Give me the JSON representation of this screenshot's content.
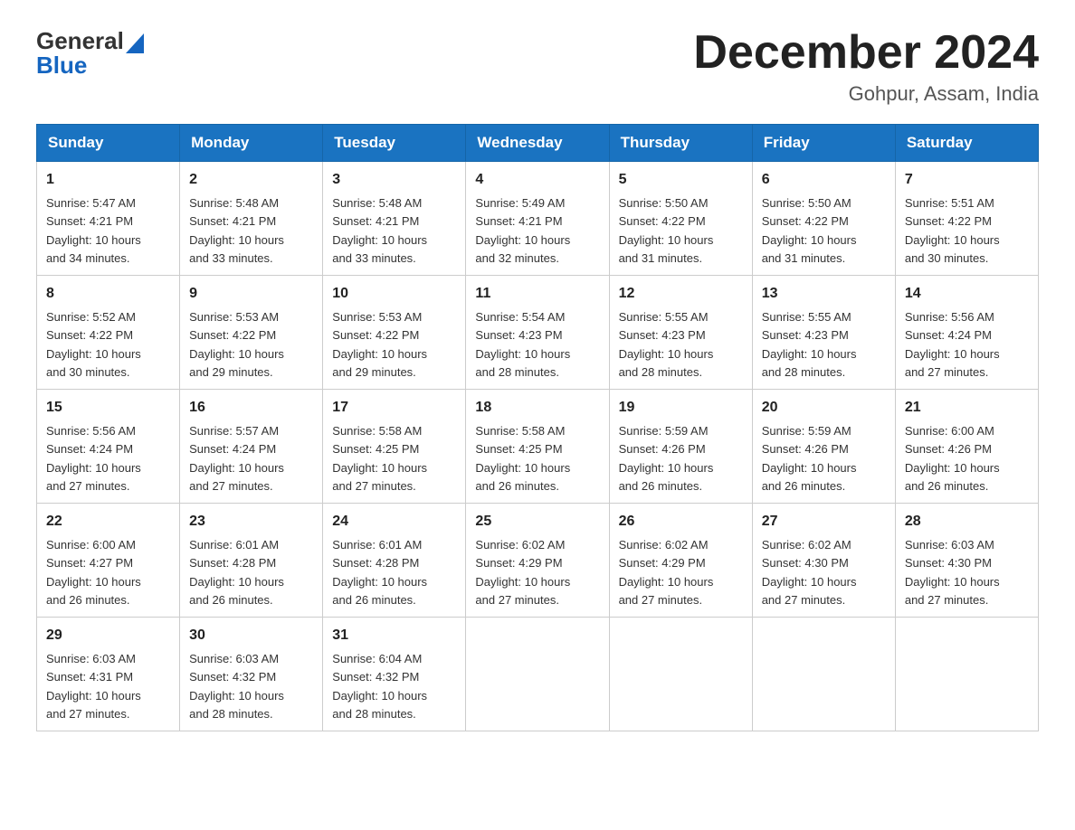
{
  "logo": {
    "text_general": "General",
    "text_blue": "Blue"
  },
  "title": {
    "month": "December 2024",
    "location": "Gohpur, Assam, India"
  },
  "days_of_week": [
    "Sunday",
    "Monday",
    "Tuesday",
    "Wednesday",
    "Thursday",
    "Friday",
    "Saturday"
  ],
  "weeks": [
    [
      {
        "day": "1",
        "sunrise": "5:47 AM",
        "sunset": "4:21 PM",
        "daylight": "10 hours and 34 minutes."
      },
      {
        "day": "2",
        "sunrise": "5:48 AM",
        "sunset": "4:21 PM",
        "daylight": "10 hours and 33 minutes."
      },
      {
        "day": "3",
        "sunrise": "5:48 AM",
        "sunset": "4:21 PM",
        "daylight": "10 hours and 33 minutes."
      },
      {
        "day": "4",
        "sunrise": "5:49 AM",
        "sunset": "4:21 PM",
        "daylight": "10 hours and 32 minutes."
      },
      {
        "day": "5",
        "sunrise": "5:50 AM",
        "sunset": "4:22 PM",
        "daylight": "10 hours and 31 minutes."
      },
      {
        "day": "6",
        "sunrise": "5:50 AM",
        "sunset": "4:22 PM",
        "daylight": "10 hours and 31 minutes."
      },
      {
        "day": "7",
        "sunrise": "5:51 AM",
        "sunset": "4:22 PM",
        "daylight": "10 hours and 30 minutes."
      }
    ],
    [
      {
        "day": "8",
        "sunrise": "5:52 AM",
        "sunset": "4:22 PM",
        "daylight": "10 hours and 30 minutes."
      },
      {
        "day": "9",
        "sunrise": "5:53 AM",
        "sunset": "4:22 PM",
        "daylight": "10 hours and 29 minutes."
      },
      {
        "day": "10",
        "sunrise": "5:53 AM",
        "sunset": "4:22 PM",
        "daylight": "10 hours and 29 minutes."
      },
      {
        "day": "11",
        "sunrise": "5:54 AM",
        "sunset": "4:23 PM",
        "daylight": "10 hours and 28 minutes."
      },
      {
        "day": "12",
        "sunrise": "5:55 AM",
        "sunset": "4:23 PM",
        "daylight": "10 hours and 28 minutes."
      },
      {
        "day": "13",
        "sunrise": "5:55 AM",
        "sunset": "4:23 PM",
        "daylight": "10 hours and 28 minutes."
      },
      {
        "day": "14",
        "sunrise": "5:56 AM",
        "sunset": "4:24 PM",
        "daylight": "10 hours and 27 minutes."
      }
    ],
    [
      {
        "day": "15",
        "sunrise": "5:56 AM",
        "sunset": "4:24 PM",
        "daylight": "10 hours and 27 minutes."
      },
      {
        "day": "16",
        "sunrise": "5:57 AM",
        "sunset": "4:24 PM",
        "daylight": "10 hours and 27 minutes."
      },
      {
        "day": "17",
        "sunrise": "5:58 AM",
        "sunset": "4:25 PM",
        "daylight": "10 hours and 27 minutes."
      },
      {
        "day": "18",
        "sunrise": "5:58 AM",
        "sunset": "4:25 PM",
        "daylight": "10 hours and 26 minutes."
      },
      {
        "day": "19",
        "sunrise": "5:59 AM",
        "sunset": "4:26 PM",
        "daylight": "10 hours and 26 minutes."
      },
      {
        "day": "20",
        "sunrise": "5:59 AM",
        "sunset": "4:26 PM",
        "daylight": "10 hours and 26 minutes."
      },
      {
        "day": "21",
        "sunrise": "6:00 AM",
        "sunset": "4:26 PM",
        "daylight": "10 hours and 26 minutes."
      }
    ],
    [
      {
        "day": "22",
        "sunrise": "6:00 AM",
        "sunset": "4:27 PM",
        "daylight": "10 hours and 26 minutes."
      },
      {
        "day": "23",
        "sunrise": "6:01 AM",
        "sunset": "4:28 PM",
        "daylight": "10 hours and 26 minutes."
      },
      {
        "day": "24",
        "sunrise": "6:01 AM",
        "sunset": "4:28 PM",
        "daylight": "10 hours and 26 minutes."
      },
      {
        "day": "25",
        "sunrise": "6:02 AM",
        "sunset": "4:29 PM",
        "daylight": "10 hours and 27 minutes."
      },
      {
        "day": "26",
        "sunrise": "6:02 AM",
        "sunset": "4:29 PM",
        "daylight": "10 hours and 27 minutes."
      },
      {
        "day": "27",
        "sunrise": "6:02 AM",
        "sunset": "4:30 PM",
        "daylight": "10 hours and 27 minutes."
      },
      {
        "day": "28",
        "sunrise": "6:03 AM",
        "sunset": "4:30 PM",
        "daylight": "10 hours and 27 minutes."
      }
    ],
    [
      {
        "day": "29",
        "sunrise": "6:03 AM",
        "sunset": "4:31 PM",
        "daylight": "10 hours and 27 minutes."
      },
      {
        "day": "30",
        "sunrise": "6:03 AM",
        "sunset": "4:32 PM",
        "daylight": "10 hours and 28 minutes."
      },
      {
        "day": "31",
        "sunrise": "6:04 AM",
        "sunset": "4:32 PM",
        "daylight": "10 hours and 28 minutes."
      },
      null,
      null,
      null,
      null
    ]
  ],
  "labels": {
    "sunrise": "Sunrise:",
    "sunset": "Sunset:",
    "daylight": "Daylight:"
  }
}
